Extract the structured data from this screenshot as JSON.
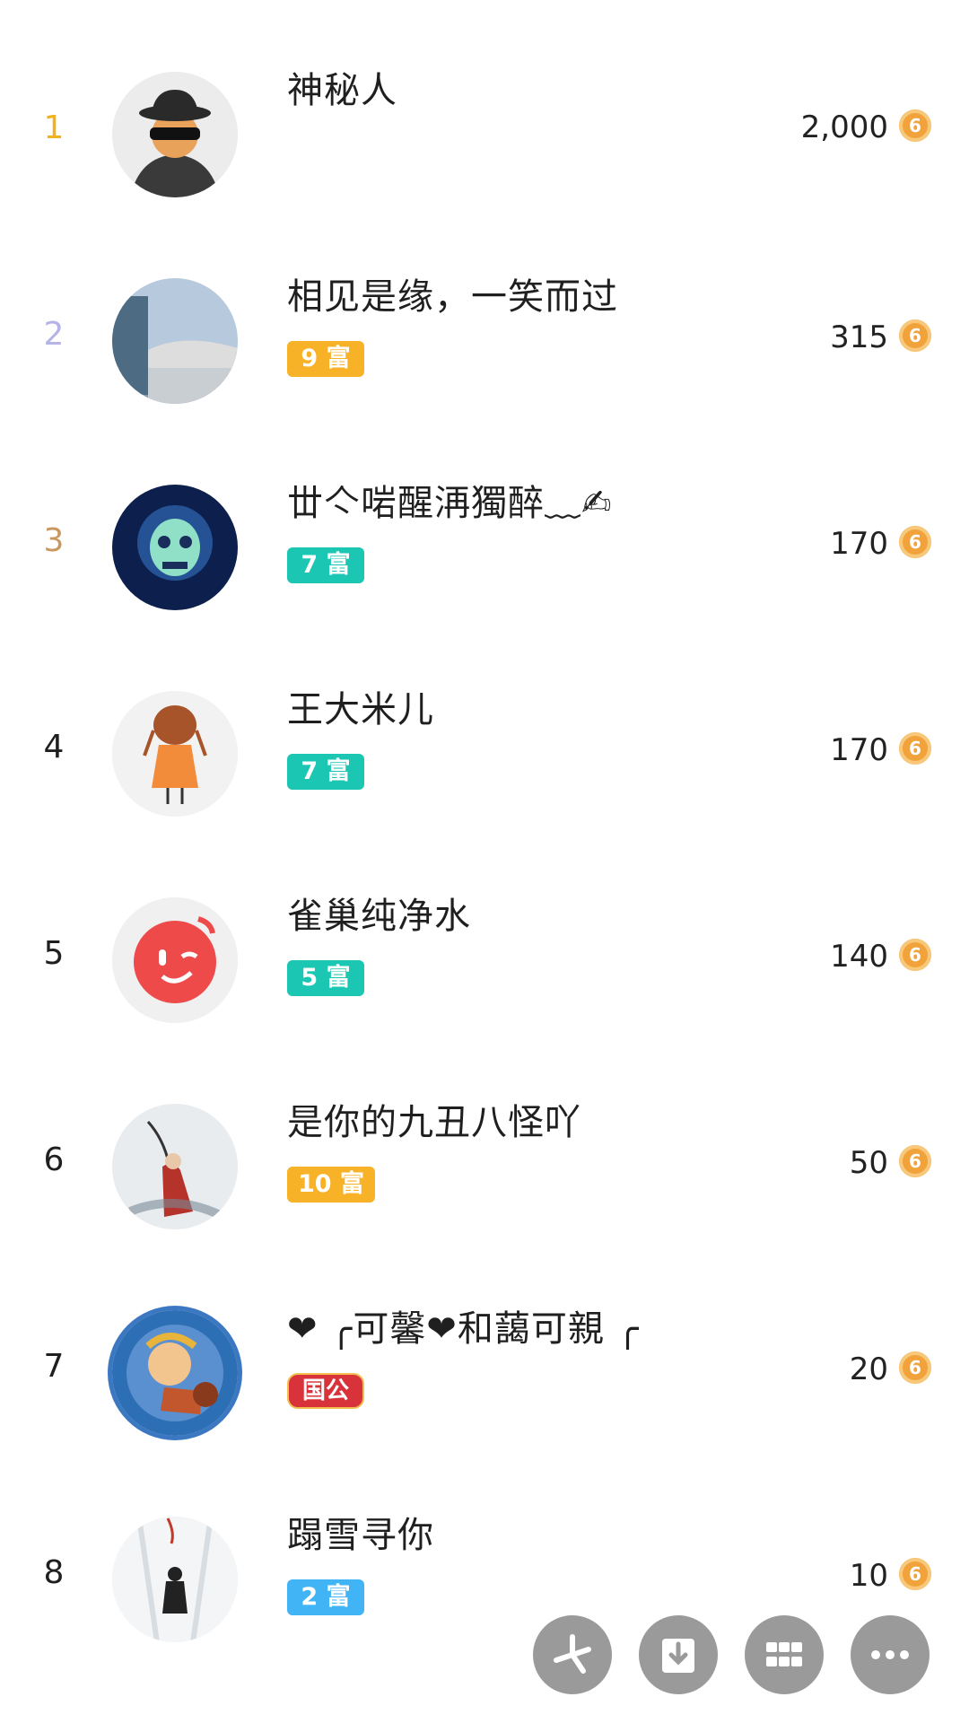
{
  "ranking": [
    {
      "rank": "1",
      "name": "神秘人",
      "badge": "",
      "score": "2,000",
      "rank_color": "#f2b21e"
    },
    {
      "rank": "2",
      "name": "相见是缘，一笑而过",
      "badge": "9 富",
      "score": "315",
      "rank_color": "#b6b4e6"
    },
    {
      "rank": "3",
      "name": "丗亽啱醒洅獨醉﹏✍",
      "badge": "7 富",
      "score": "170",
      "rank_color": "#c9985e"
    },
    {
      "rank": "4",
      "name": "王大米儿",
      "badge": "7 富",
      "score": "170",
      "rank_color": "#1f1f1f"
    },
    {
      "rank": "5",
      "name": "雀巢纯净水",
      "badge": "5 富",
      "score": "140",
      "rank_color": "#1f1f1f"
    },
    {
      "rank": "6",
      "name": "是你的九丑八怪吖",
      "badge": "10 富",
      "score": "50",
      "rank_color": "#1f1f1f"
    },
    {
      "rank": "7",
      "name": "❤ ╭可馨❤和藹可親 ╭",
      "badge": "国公",
      "score": "20",
      "rank_color": "#1f1f1f"
    },
    {
      "rank": "8",
      "name": "蹋雪寻你",
      "badge": "2 富",
      "score": "10",
      "rank_color": "#1f1f1f"
    }
  ],
  "coin_icon": "coin-icon",
  "toolbar_icons": [
    "pinwheel-icon",
    "download-icon",
    "grid-icon",
    "more-icon"
  ]
}
